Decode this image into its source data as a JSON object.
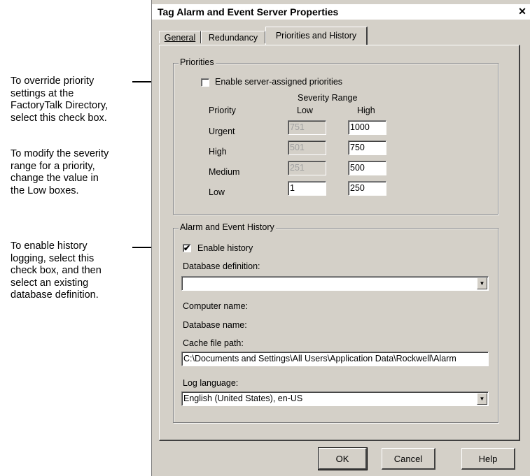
{
  "annotations": {
    "override": [
      "To override priority",
      "settings at the",
      "FactoryTalk Directory,",
      "select this check box."
    ],
    "severity": [
      "To modify the severity",
      "range for a priority,",
      "change the value in",
      "the Low boxes."
    ],
    "history": [
      "To enable history",
      "logging, select this",
      "check box, and then",
      "select an existing",
      "database definition."
    ]
  },
  "dialog": {
    "title": "Tag Alarm and Event Server Properties",
    "close_glyph": "✕",
    "tabs": [
      "General",
      "Redundancy",
      "Priorities and History"
    ],
    "active_tab": "Priorities and History"
  },
  "priorities": {
    "group_label": "Priorities",
    "enable_label": "Enable server-assigned priorities",
    "enable_checked": false,
    "severity_range_label": "Severity Range",
    "col_priority": "Priority",
    "col_low": "Low",
    "col_high": "High",
    "rows": [
      {
        "name": "Urgent",
        "low": "751",
        "high": "1000",
        "low_enabled": false
      },
      {
        "name": "High",
        "low": "501",
        "high": "750",
        "low_enabled": false
      },
      {
        "name": "Medium",
        "low": "251",
        "high": "500",
        "low_enabled": false
      },
      {
        "name": "Low",
        "low": "1",
        "high": "250",
        "low_enabled": true
      }
    ]
  },
  "history": {
    "group_label": "Alarm and Event History",
    "enable_label": "Enable history",
    "enable_checked": true,
    "checkmark": "✔",
    "db_def_label": "Database definition:",
    "db_def_value": "",
    "computer_name_label": "Computer name:",
    "database_name_label": "Database name:",
    "cache_path_label": "Cache file path:",
    "cache_path_value": "C:\\Documents and Settings\\All Users\\Application Data\\Rockwell\\Alarm",
    "log_language_label": "Log language:",
    "log_language_value": "English (United States), en-US",
    "dropdown_glyph": "▼"
  },
  "buttons": {
    "ok": "OK",
    "cancel": "Cancel",
    "help": "Help"
  }
}
